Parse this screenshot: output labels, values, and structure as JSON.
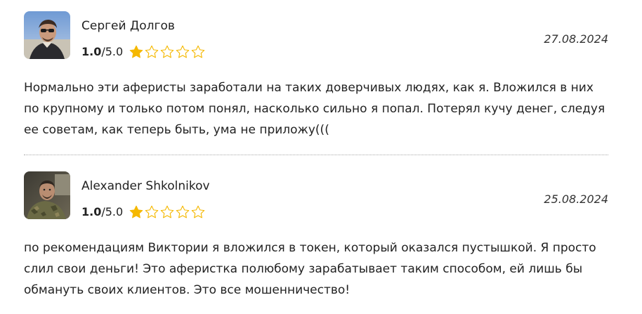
{
  "reviews": [
    {
      "author": "Сергей Долгов",
      "score": "1.0",
      "score_max": "/5.0",
      "stars_filled": 1,
      "stars_total": 5,
      "date": "27.08.2024",
      "text": "Нормально эти аферисты заработали на таких доверчивых людях, как я. Вложился в них по крупному и только потом понял, насколько сильно я попал. Потерял кучу денег, следуя ее советам, как теперь быть, ума не приложу((("
    },
    {
      "author": "Alexander Shkolnikov",
      "score": "1.0",
      "score_max": "/5.0",
      "stars_filled": 1,
      "stars_total": 5,
      "date": "25.08.2024",
      "text": "по рекомендациям Виктории я вложился в токен, который оказался пустышкой. Я просто слил свои деньги! Это аферистка полюбому зарабатывает таким способом, ей лишь бы обмануть своих клиентов. Это все мошенничество!"
    }
  ],
  "colors": {
    "star": "#f5b800",
    "divider": "#a8a8a8"
  },
  "icons": {
    "star_full": "star-icon",
    "star_empty": "star-outline-icon"
  }
}
